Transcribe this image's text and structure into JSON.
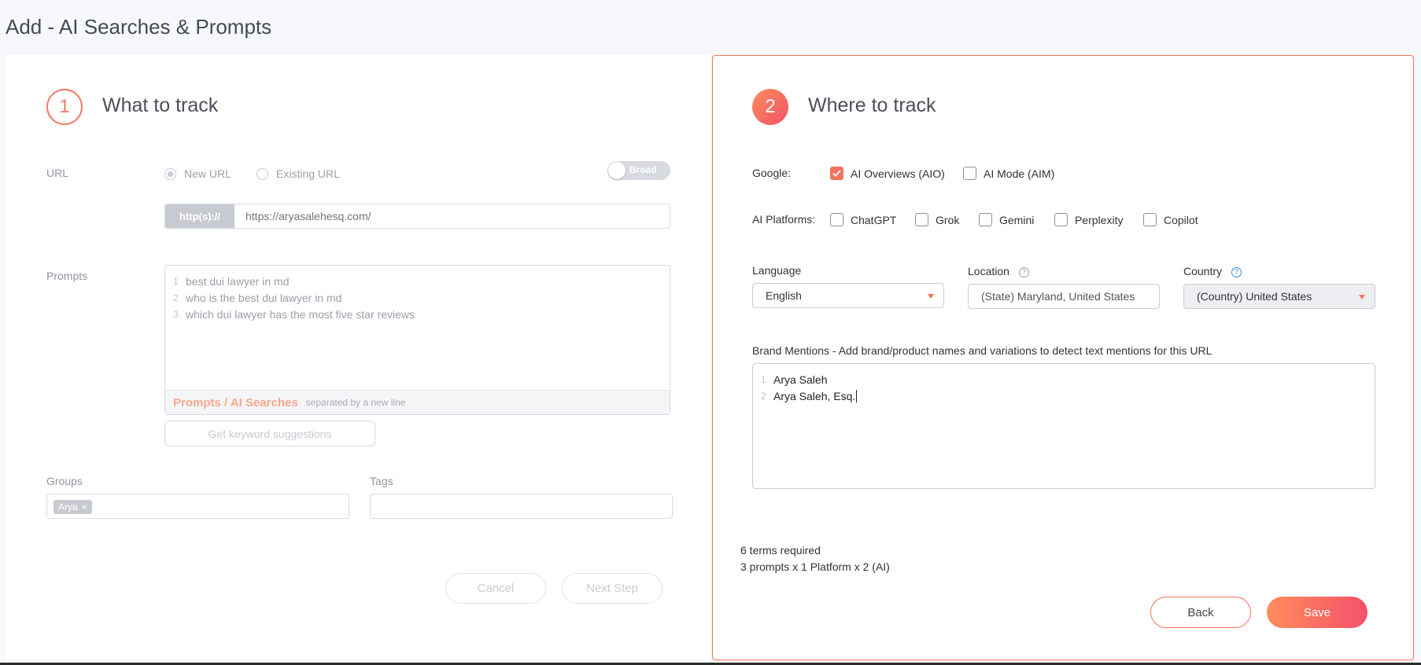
{
  "page": {
    "title": "Add - AI Searches & Prompts"
  },
  "step1": {
    "number": "1",
    "title": "What to track",
    "url_label": "URL",
    "radio_new": "New URL",
    "radio_existing": "Existing URL",
    "toggle_label": "Broad",
    "url_prefix": "http(s)://",
    "url_placeholder": "https://aryasalehesq.com/",
    "prompts_label": "Prompts",
    "prompts": [
      {
        "n": "1",
        "text": "best dui lawyer in md"
      },
      {
        "n": "2",
        "text": "who is the best dui lawyer in md"
      },
      {
        "n": "3",
        "text": "which dui lawyer has the most five star reviews"
      }
    ],
    "prompts_footer_highlight": "Prompts / AI Searches",
    "prompts_footer_sub": "separated by a new line",
    "suggest_button": "Get keyword suggestions",
    "groups_label": "Groups",
    "group_chip": "Arya",
    "group_chip_remove": "×",
    "tags_label": "Tags",
    "cancel_button": "Cancel",
    "next_button": "Next Step"
  },
  "step2": {
    "number": "2",
    "title": "Where to track",
    "google_label": "Google:",
    "google_options": [
      {
        "label": "AI Overviews (AIO)",
        "checked": true
      },
      {
        "label": "AI Mode (AIM)",
        "checked": false
      }
    ],
    "platforms_label": "AI Platforms:",
    "platforms": [
      {
        "label": "ChatGPT",
        "checked": false
      },
      {
        "label": "Grok",
        "checked": false
      },
      {
        "label": "Gemini",
        "checked": false
      },
      {
        "label": "Perplexity",
        "checked": false
      },
      {
        "label": "Copilot",
        "checked": false
      }
    ],
    "language_label": "Language",
    "language_value": "English",
    "location_label": "Location",
    "location_value": "(State) Maryland, United States",
    "country_label": "Country",
    "country_value": "(Country) United States",
    "brand_label": "Brand Mentions - Add brand/product names and variations to detect text mentions for this URL",
    "brand_lines": [
      {
        "n": "1",
        "text": "Arya Saleh"
      },
      {
        "n": "2",
        "text": "Arya Saleh, Esq."
      }
    ],
    "summary_line1": "6 terms required",
    "summary_line2": "3 prompts x 1 Platform x 2 (AI)",
    "back_button": "Back",
    "save_button": "Save"
  },
  "colors": {
    "accent": "#f2735e",
    "accent_gradient_end": "#f4516a",
    "help_gray": "#8f96a3",
    "help_blue": "#2f8fe8"
  },
  "icons": {
    "check": "check-icon",
    "caret": "caret-down-icon",
    "help": "help-icon",
    "close": "close-icon"
  }
}
